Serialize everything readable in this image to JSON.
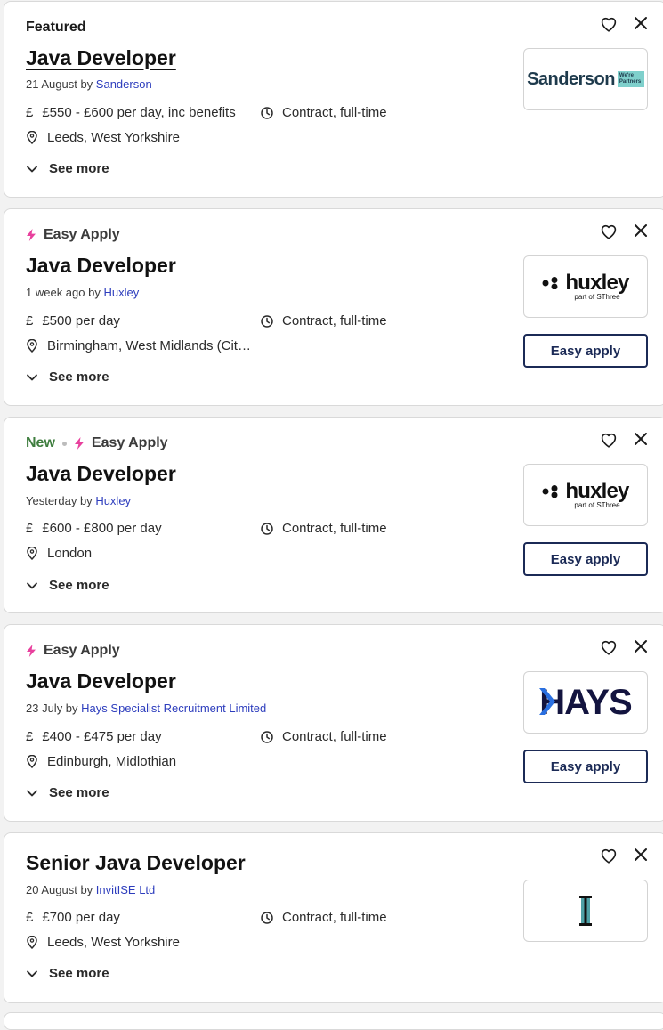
{
  "ui": {
    "see_more": "See more",
    "easy_apply_button": "Easy apply"
  },
  "colors": {
    "company_link": "#2d3dbd",
    "easy_apply_bolt": "#e8409d",
    "new_badge": "#3f7e3f",
    "button_border": "#1b2a56"
  },
  "jobs": [
    {
      "badge": "Featured",
      "title": "Java Developer",
      "posted": "21 August by",
      "company": "Sanderson",
      "salary": "£550 - £600 per day, inc benefits",
      "job_type": "Contract, full-time",
      "location": "Leeds, West Yorkshire",
      "logo_text": "Sanderson",
      "logo_tag": "We're Partners"
    },
    {
      "badge": "Easy Apply",
      "title": "Java Developer",
      "posted": "1 week ago by",
      "company": "Huxley",
      "salary": "£500 per day",
      "job_type": "Contract, full-time",
      "location": "Birmingham, West Midlands (City Centre)",
      "logo_text": "huxley",
      "logo_sub": "part of SThree"
    },
    {
      "new_badge": "New",
      "badge": "Easy Apply",
      "title": "Java Developer",
      "posted": "Yesterday by",
      "company": "Huxley",
      "salary": "£600 - £800 per day",
      "job_type": "Contract, full-time",
      "location": "London",
      "logo_text": "huxley",
      "logo_sub": "part of SThree"
    },
    {
      "badge": "Easy Apply",
      "title": "Java Developer",
      "posted": "23 July by",
      "company": "Hays Specialist Recruitment Limited",
      "salary": "£400 - £475 per day",
      "job_type": "Contract, full-time",
      "location": "Edinburgh, Midlothian",
      "logo_text": "HAYS"
    },
    {
      "title": "Senior Java Developer",
      "posted": "20 August by",
      "company": "InvitISE Ltd",
      "salary": "£700 per day",
      "job_type": "Contract, full-time",
      "location": "Leeds, West Yorkshire"
    }
  ]
}
